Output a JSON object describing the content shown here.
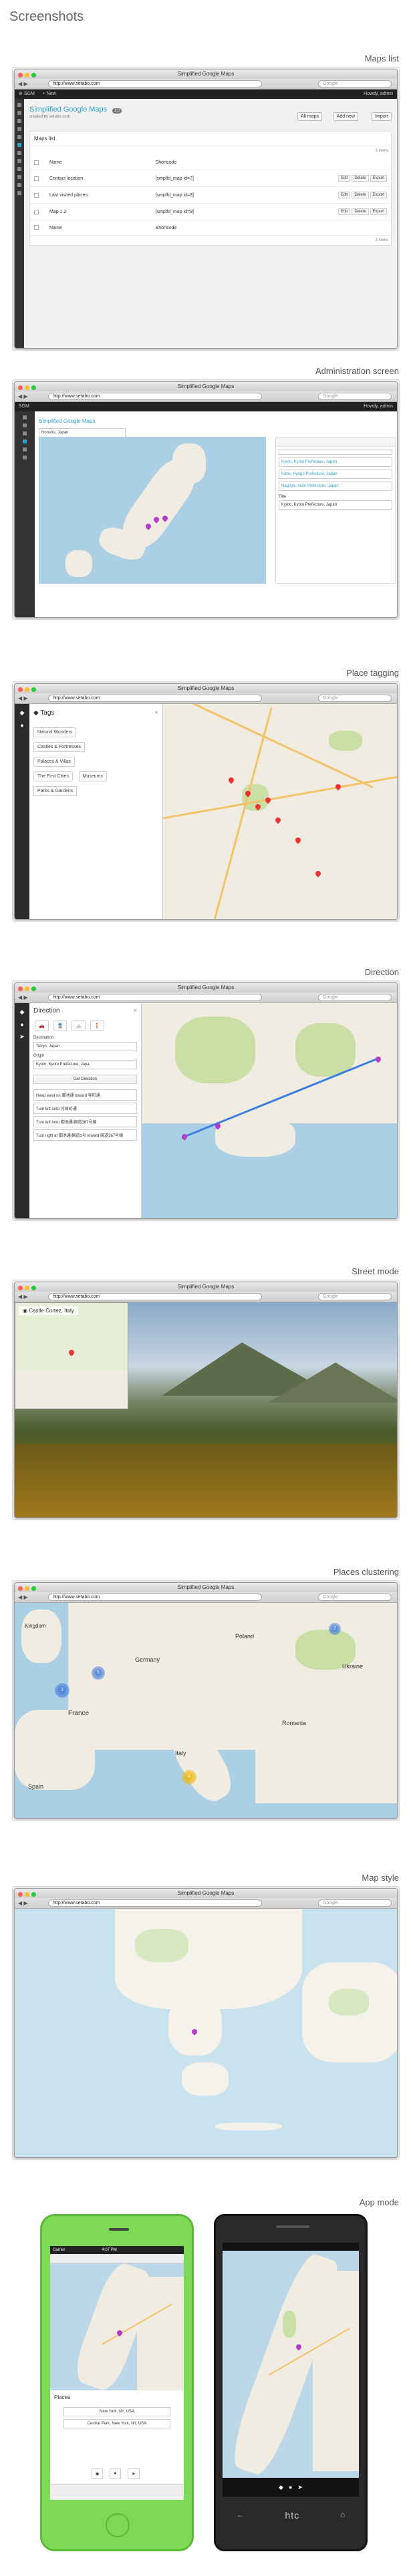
{
  "page": {
    "title": "Screenshots"
  },
  "browser": {
    "title": "Simplified Google Maps",
    "url": "http://www.setabo.com",
    "search": "Google"
  },
  "sections": {
    "maps_list": "Maps list",
    "admin": "Administration screen",
    "tagging": "Place tagging",
    "direction": "Direction",
    "street": "Street mode",
    "clustering": "Places clustering",
    "style": "Map style",
    "app": "App mode"
  },
  "wp": {
    "site": "SGM",
    "howdy": "Howdy, admin",
    "new": "+ New",
    "plugin": "Simplified Google Maps",
    "version": "1.0",
    "created_by": "created by setabo.com",
    "btn_all": "All maps",
    "btn_add": "Add new",
    "btn_import": "Import",
    "panel_title": "Maps list",
    "items_top": "3 items",
    "items_bottom": "3 items",
    "col_name": "Name",
    "col_shortcode": "Shortcode",
    "rows": [
      {
        "name": "Contact location",
        "shortcode": "[smplfd_map id=7]"
      },
      {
        "name": "Last visited places",
        "shortcode": "[smplfd_map id=8]"
      },
      {
        "name": "Map 1.2",
        "shortcode": "[smplfd_map id=9]"
      }
    ],
    "act_edit": "Edit",
    "act_delete": "Delete",
    "act_export": "Export"
  },
  "admin": {
    "search": "Honshu, Japan",
    "places": [
      "Kyoto, Kyoto Prefecture, Japan",
      "Kobe, Hyogo Prefecture, Japan",
      "Nagoya, Aichi Prefecture, Japan"
    ],
    "field_label": "Title",
    "field_value": "Kyoto, Kyoto Prefecture, Japan"
  },
  "tagging": {
    "heading": "Tags",
    "tags": [
      "Natural Wonders",
      "Castles & Fortresses",
      "Palaces & Villas",
      "The First Cities",
      "Museums",
      "Parks & Gardens"
    ]
  },
  "direction": {
    "heading": "Direction",
    "dest_label": "Destination",
    "dest": "Tokyo, Japan",
    "origin_label": "Origin",
    "origin": "Kyoto, Kyoto Prefecture, Japa",
    "button": "Get Direction",
    "steps": [
      "Head west on 御池通 toward 寺町通",
      "Turn left onto 河原町通",
      "Turn left onto 御池通/国道367号線",
      "Turn right at 御池通/国道1号 toward 国道367号線"
    ]
  },
  "street": {
    "location": "Castle Cortez, Italy"
  },
  "clustering": {
    "countries": [
      "Kingdom",
      "Germany",
      "Poland",
      "France",
      "Italy",
      "Spain",
      "Ukraine",
      "Romania"
    ],
    "clusters": [
      "3",
      "5",
      "2",
      "4"
    ]
  },
  "app": {
    "carrier": "Carrier",
    "time": "4:07 PM",
    "places_label": "Places",
    "places": [
      "New York, NY, USA",
      "Central Park, New York, NY, USA"
    ],
    "brand": "htc"
  },
  "colors": {
    "accent": "#2ea2cc",
    "pin": "#e33333",
    "pin_purple": "#b43cc8",
    "water": "#abd0e6",
    "land": "#f0ece2"
  }
}
